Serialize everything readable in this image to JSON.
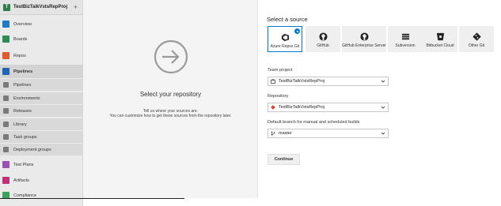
{
  "project": {
    "badge": "T",
    "name": "TestBizTalkVstsRepProj",
    "add": "+"
  },
  "sidebar": {
    "items": [
      {
        "label": "Overview",
        "color": "#1e7bc4"
      },
      {
        "label": "Boards",
        "color": "#2e8b57"
      },
      {
        "label": "Repos",
        "color": "#e05a2b"
      },
      {
        "label": "Pipelines",
        "color": "#1f65b7"
      },
      {
        "label": "Pipelines"
      },
      {
        "label": "Environments"
      },
      {
        "label": "Releases"
      },
      {
        "label": "Library"
      },
      {
        "label": "Task groups"
      },
      {
        "label": "Deployment groups"
      },
      {
        "label": "Test Plans",
        "color": "#9b4fb5"
      },
      {
        "label": "Artifacts",
        "color": "#c2307a"
      },
      {
        "label": "Compliance",
        "color": "#3aa55a"
      }
    ]
  },
  "center": {
    "title": "Select your repository",
    "line1": "Tell us where your sources are.",
    "line2": "You can customize how to get these sources from the repository later."
  },
  "source": {
    "title": "Select a source",
    "tiles": [
      {
        "label": "Azure Repos Git",
        "icon": "azure-repos-icon"
      },
      {
        "label": "GitHub",
        "icon": "github-icon"
      },
      {
        "label": "GitHub Enterprise Server",
        "icon": "github-enterprise-icon"
      },
      {
        "label": "Subversion",
        "icon": "subversion-icon"
      },
      {
        "label": "Bitbucket Cloud",
        "icon": "bitbucket-icon"
      },
      {
        "label": "Other Git",
        "icon": "git-icon"
      }
    ]
  },
  "form": {
    "team_project_label": "Team project",
    "team_project_value": "TestBizTalkVstsRepProj",
    "repository_label": "Repository",
    "repository_value": "TestBizTalkVstsRepProj",
    "branch_label": "Default branch for manual and scheduled builds",
    "branch_value": "master"
  },
  "continue_label": "Continue",
  "colors": {
    "accent": "#0078d4",
    "git": "#e24329"
  }
}
